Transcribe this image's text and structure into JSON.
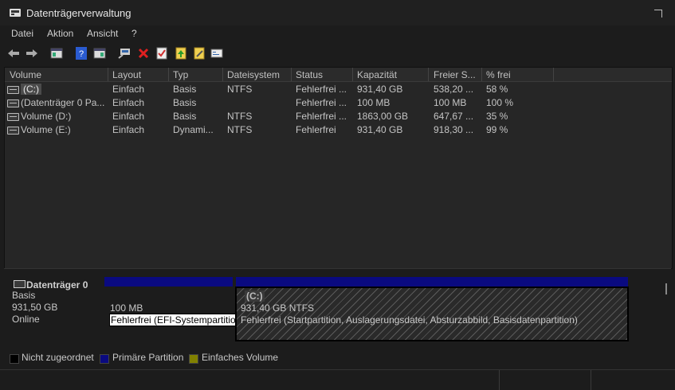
{
  "window": {
    "title": "Datenträgerverwaltung"
  },
  "menu": [
    "Datei",
    "Aktion",
    "Ansicht",
    "?"
  ],
  "toolbar": {
    "icons": [
      "back-arrow-icon",
      "forward-arrow-icon",
      "console-tree-icon",
      "help-icon",
      "properties-pane-icon",
      "connect-icon",
      "delete-icon",
      "checklist-icon",
      "rescan-icon",
      "edit-icon",
      "settings-icon"
    ]
  },
  "volumes": {
    "columns": [
      "Volume",
      "Layout",
      "Typ",
      "Dateisystem",
      "Status",
      "Kapazität",
      "Freier S...",
      "% frei"
    ],
    "rows": [
      [
        "(C:)",
        "Einfach",
        "Basis",
        "NTFS",
        "Fehlerfrei ...",
        "931,40 GB",
        "538,20 ...",
        "58 %"
      ],
      [
        "(Datenträger 0 Pa...",
        "Einfach",
        "Basis",
        "",
        "Fehlerfrei ...",
        "100 MB",
        "100 MB",
        "100 %"
      ],
      [
        "Volume (D:)",
        "Einfach",
        "Basis",
        "NTFS",
        "Fehlerfrei ...",
        "1863,00 GB",
        "647,67 ...",
        "35 %"
      ],
      [
        "Volume (E:)",
        "Einfach",
        "Dynami...",
        "NTFS",
        "Fehlerfrei",
        "931,40 GB",
        "918,30 ...",
        "99 %"
      ]
    ]
  },
  "disk": {
    "name": "Datenträger 0",
    "type": "Basis",
    "size": "931,50 GB",
    "state": "Online",
    "partitions": [
      {
        "size": "100 MB",
        "status": "Fehlerfrei (EFI-Systempartition)"
      },
      {
        "label": "(C:)",
        "size": "931,40 GB NTFS",
        "status": "Fehlerfrei (Startpartition, Auslagerungsdatei, Absturzabbild, Basisdatenpartition)"
      }
    ]
  },
  "legend": [
    {
      "label": "Nicht zugeordnet",
      "color": "#000000"
    },
    {
      "label": "Primäre Partition",
      "color": "#0a0a80"
    },
    {
      "label": "Einfaches Volume",
      "color": "#808000"
    }
  ]
}
